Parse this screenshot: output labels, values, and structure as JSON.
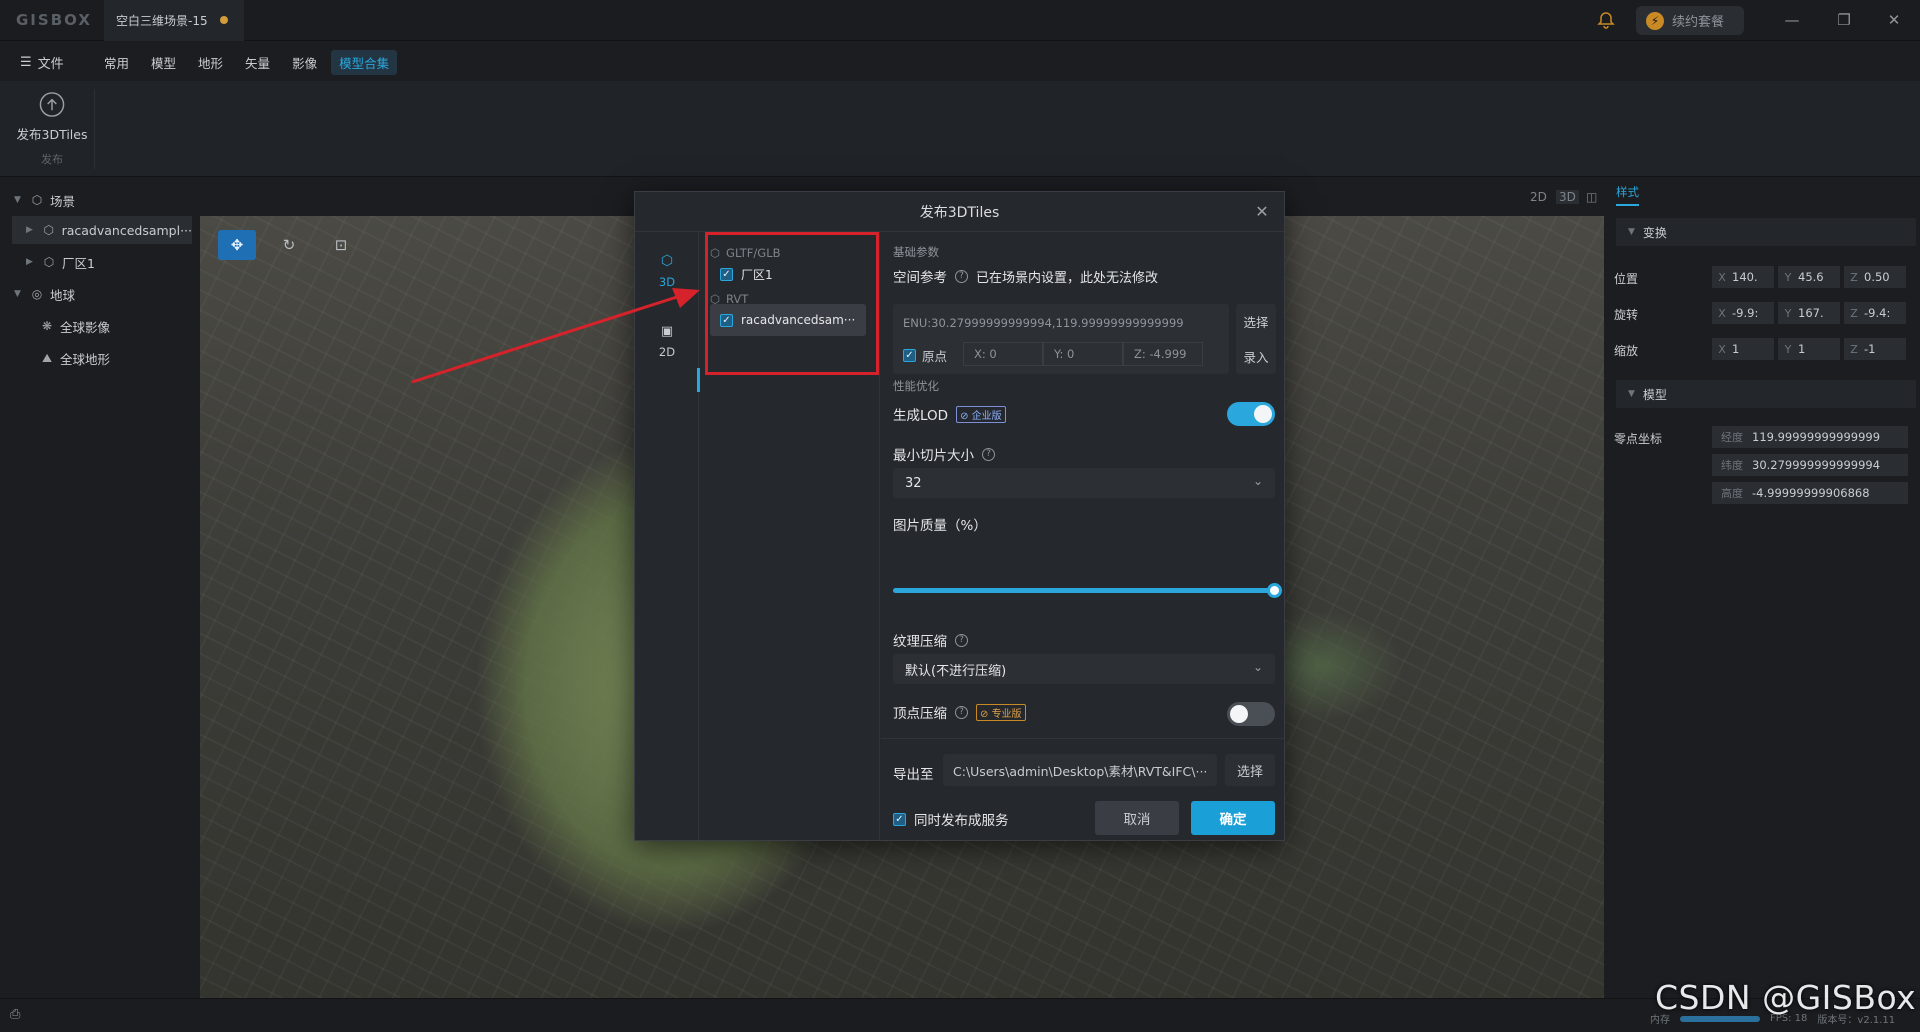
{
  "app": {
    "logo": "GISBOX",
    "doc_tab": "空白三维场景-15",
    "renew_label": "续约套餐",
    "window_buttons": [
      "minimize-icon",
      "restore-icon",
      "close-icon"
    ]
  },
  "menu": {
    "file": "文件",
    "items": [
      "常用",
      "模型",
      "地形",
      "矢量",
      "影像",
      "模型合集"
    ],
    "active_index": 5
  },
  "ribbon": {
    "publish_label": "发布3DTiles",
    "group_label": "发布"
  },
  "tree": {
    "scene": "场景",
    "items": [
      "racadvancedsampl···",
      "厂区1"
    ],
    "earth": "地球",
    "earth_items": [
      "全球影像",
      "全球地形"
    ]
  },
  "view_modes": [
    "2D",
    "3D"
  ],
  "right_panel": {
    "tab": "样式",
    "transform_section": "变换",
    "position_label": "位置",
    "position": [
      "140.",
      "45.6",
      "0.50"
    ],
    "rotation_label": "旋转",
    "rotation": [
      "-9.9:",
      "167.",
      "-9.4:"
    ],
    "scale_label": "缩放",
    "scale": [
      "1",
      "1",
      "-1"
    ],
    "model_section": "模型",
    "zero_label": "零点坐标",
    "lon_label": "经度",
    "lon": "119.99999999999999",
    "lat_label": "纬度",
    "lat": "30.279999999999994",
    "alt_label": "高度",
    "alt": "-4.99999999906868",
    "axis_labels": [
      "X",
      "Y",
      "Z"
    ]
  },
  "dialog": {
    "title": "发布3DTiles",
    "rail": [
      "3D",
      "2D"
    ],
    "groups": {
      "gltf": "GLTF/GLB",
      "gltf_item": "厂区1",
      "rvt": "RVT",
      "rvt_item": "racadvancedsam···"
    },
    "basic_section": "基础参数",
    "spatial_ref_label": "空间参考",
    "spatial_ref_hint": "已在场景内设置，此处无法修改",
    "enu_value": "ENU:30.27999999999994,119.99999999999999",
    "origin_label": "原点",
    "origin_coords": [
      "X:  0",
      "Y:  0",
      "Z:  -4.999"
    ],
    "select_label": "选择",
    "input_label": "录入",
    "perf_section": "性能优化",
    "lod_label": "生成LOD",
    "lod_badge": "企业版",
    "lod_on": true,
    "min_tile_label": "最小切片大小",
    "min_tile_value": "32",
    "quality_label": "图片质量（%）",
    "quality_value": 100,
    "texture_label": "纹理压缩",
    "texture_value": "默认(不进行压缩)",
    "vertex_label": "顶点压缩",
    "vertex_badge": "专业版",
    "vertex_on": false,
    "export_label": "导出至",
    "export_path": "C:\\Users\\admin\\Desktop\\素材\\RVT&IFC\\···",
    "export_select": "选择",
    "also_publish": "同时发布成服务",
    "cancel": "取消",
    "confirm": "确定"
  },
  "status": {
    "memory_label": "内存",
    "fps": "FPS: 18",
    "version": "版本号：v2.1.11"
  },
  "watermark": "CSDN @GISBox",
  "colors": {
    "accent": "#2aa7dc",
    "annotation": "#d6222b"
  }
}
